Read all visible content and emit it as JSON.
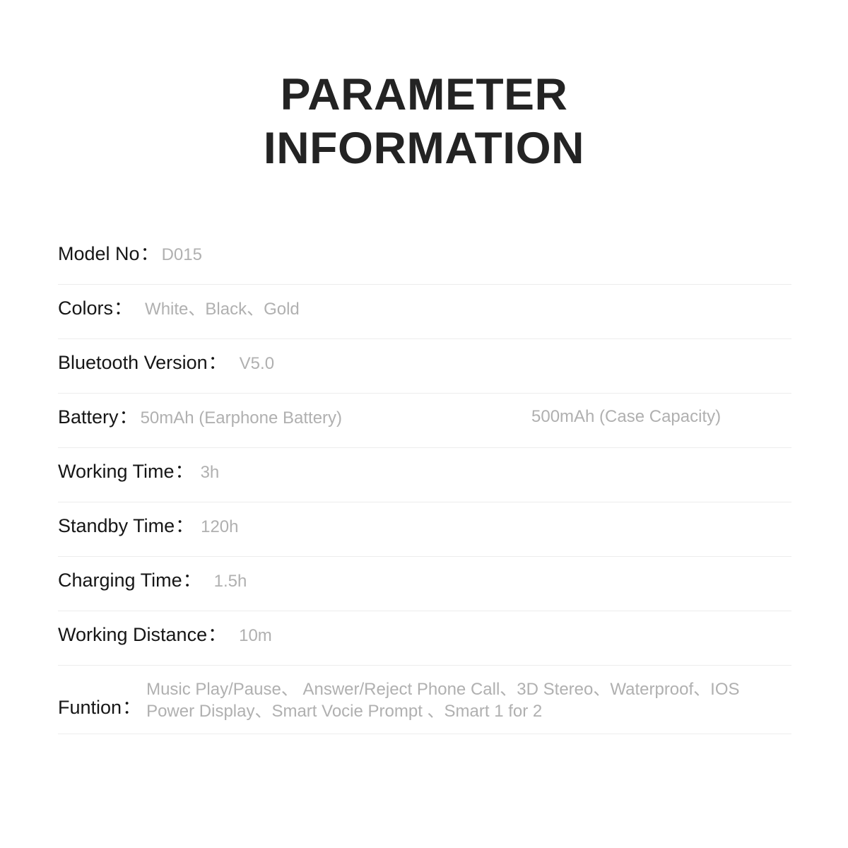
{
  "page": {
    "background_color": "#ffffff",
    "label_color": "#161616",
    "value_color": "#b0b0b0",
    "divider_color": "#ededed",
    "title_color": "#232323"
  },
  "title": {
    "line1": "PARAMETER",
    "line2": "INFORMATION"
  },
  "spec_table": {
    "colon": "：",
    "rows": [
      {
        "label": "Model No",
        "value": "D015"
      },
      {
        "label": "Colors",
        "value": "White、Black、Gold"
      },
      {
        "label": "Bluetooth Version",
        "value": "V5.0"
      },
      {
        "label": "Battery",
        "value": "50mAh (Earphone Battery)",
        "value2": "500mAh (Case Capacity)"
      },
      {
        "label": "Working Time",
        "value": "3h"
      },
      {
        "label": "Standby Time",
        "value": "120h"
      },
      {
        "label": "Charging Time",
        "value": "1.5h"
      },
      {
        "label": "Working Distance",
        "value": "10m"
      },
      {
        "label": "Funtion",
        "value_line1": "Music Play/Pause、 Answer/Reject Phone Call、3D Stereo、Waterproof、IOS",
        "value_line2": "Power Display、Smart Vocie Prompt 、Smart 1 for 2"
      }
    ]
  }
}
